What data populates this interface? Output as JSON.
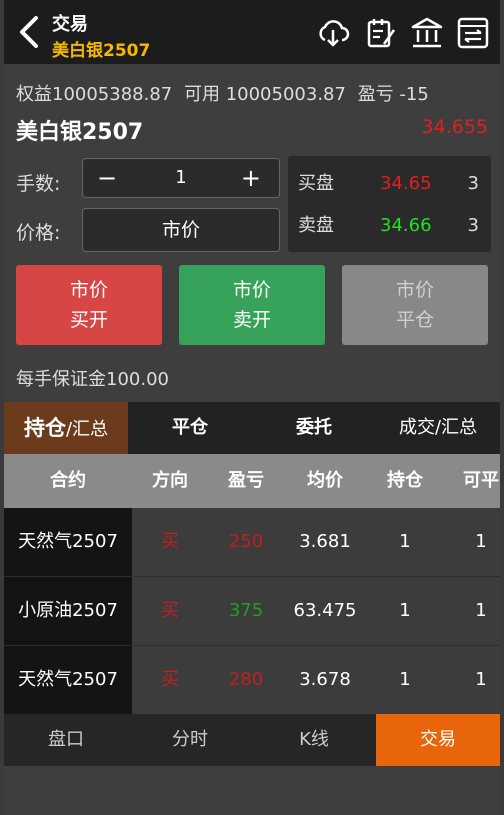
{
  "header": {
    "title": "交易",
    "subtitle": "美白银2507"
  },
  "account": {
    "equity": "权益10005388.87",
    "available": "可用 10005003.87",
    "pnl": "盈亏 -15"
  },
  "contract": {
    "name": "美白银2507",
    "last_price": "34.655"
  },
  "order": {
    "qty_label": "手数:",
    "qty_value": "1",
    "minus": "−",
    "plus": "+",
    "price_label": "价格:",
    "price_value": "市价"
  },
  "book": {
    "bid_label": "买盘",
    "bid_price": "34.65",
    "bid_qty": "3",
    "ask_label": "卖盘",
    "ask_price": "34.66",
    "ask_qty": "3"
  },
  "buttons": {
    "buy_line1": "市价",
    "buy_line2": "买开",
    "sell_line1": "市价",
    "sell_line2": "卖开",
    "close_line1": "市价",
    "close_line2": "平仓"
  },
  "margin_text": "每手保证金100.00",
  "tabs": {
    "positions_main": "持仓",
    "positions_sub": "/汇总",
    "close": "平仓",
    "orders": "委托",
    "trades": "成交/汇总"
  },
  "table": {
    "headers": [
      "合约",
      "方向",
      "盈亏",
      "均价",
      "持仓",
      "可平"
    ],
    "rows": [
      {
        "name": "天然气2507",
        "dir": "买",
        "pnl": "250",
        "avg": "3.681",
        "pos": "1",
        "avail": "1"
      },
      {
        "name": "小原油2507",
        "dir": "买",
        "pnl": "375",
        "avg": "63.475",
        "pos": "1",
        "avail": "1"
      },
      {
        "name": "天然气2507",
        "dir": "买",
        "pnl": "280",
        "avg": "3.678",
        "pos": "1",
        "avail": "1"
      }
    ]
  },
  "nav": {
    "quote": "盘口",
    "timeshare": "分时",
    "kline": "K线",
    "trade": "交易"
  },
  "colors": {
    "up": "#e02020",
    "down": "#20e020",
    "accent": "#e8650c",
    "brand_yellow": "#f5b800"
  }
}
